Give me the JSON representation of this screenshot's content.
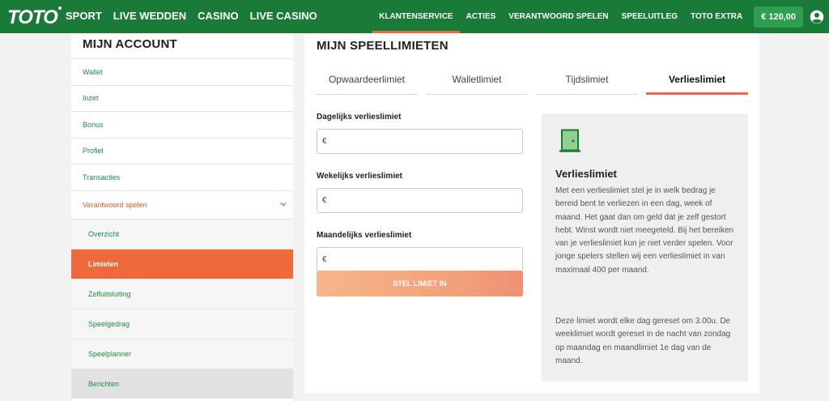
{
  "brand": {
    "logo_text": "TOTO"
  },
  "nav": {
    "main": [
      "SPORT",
      "LIVE WEDDEN",
      "CASINO",
      "LIVE CASINO"
    ],
    "right": [
      "KLANTENSERVICE",
      "ACTIES",
      "VERANTWOORD SPELEN",
      "SPEELUITLEG",
      "TOTO EXTRA"
    ],
    "active_right": "KLANTENSERVICE",
    "balance": "€ 120,00",
    "user_icon": "user-circle-icon"
  },
  "sidebar": {
    "title": "MIJN ACCOUNT",
    "items": [
      "Wallet",
      "Inzet",
      "Bonus",
      "Profiel",
      "Transacties"
    ],
    "open_item": "Verantwoord spelen",
    "sub_items": [
      "Overzicht",
      "Limieten",
      "Zelfuitsluiting",
      "Speelgedrag",
      "Speelplanner",
      "Berichten"
    ],
    "active_sub": "Limieten"
  },
  "main": {
    "title": "MIJN SPEELLIMIETEN",
    "tabs": [
      "Opwaardeerlimiet",
      "Walletlimiet",
      "Tijdslimiet",
      "Verlieslimiet"
    ],
    "active_tab": "Verlieslimiet",
    "form": {
      "daily_label": "Dagelijks verlieslimiet",
      "weekly_label": "Wekelijks verlieslimiet",
      "monthly_label": "Maandelijks verlieslimiet",
      "currency": "€",
      "submit_label": "STEL LIMIET IN"
    },
    "info": {
      "icon": "door-icon",
      "title": "Verlieslimiet",
      "paragraph1": "Met een verlieslimiet stel je in welk bedrag je bereid bent te verliezen in een dag, week of maand. Het gaat dan om geld dat je zelf gestort hebt. Winst wordt niet meegeteld. Bij het bereiken van je verlieslimiet kun je niet verder spelen. Voor jonge spelers stellen wij een verlieslimiet in van maximaal 400 per maand.",
      "paragraph2": "Deze limiet wordt elke dag gereset om 3.00u. De weeklimiet wordt gereset in de nacht van zondag op maandag en maandlimiet 1e dag van de maand."
    }
  },
  "colors": {
    "brand_green": "#1a7a38",
    "accent_orange": "#ee6a3c",
    "link_green": "#1f8a43"
  }
}
